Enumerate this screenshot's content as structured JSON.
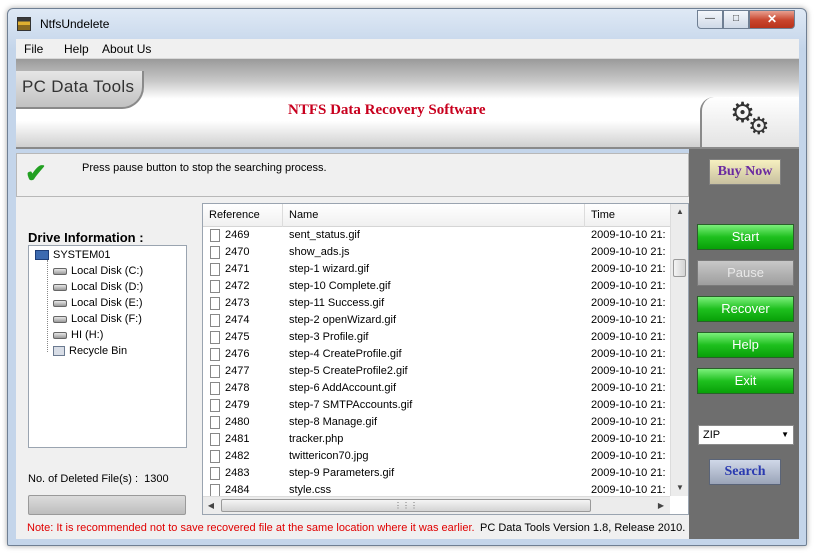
{
  "window": {
    "title": "NtfsUndelete"
  },
  "menu": [
    "File",
    "Help",
    "About Us"
  ],
  "banner": {
    "logo": "PC Data Tools",
    "title": "NTFS Data Recovery Software"
  },
  "status": {
    "message": "Press pause button to stop the searching process."
  },
  "drive_info": {
    "label": "Drive Information :",
    "root": "SYSTEM01",
    "items": [
      "Local Disk (C:)",
      "Local Disk (D:)",
      "Local Disk (E:)",
      "Local Disk (F:)",
      "HI (H:)",
      "Recycle Bin"
    ]
  },
  "deleted": {
    "label": "No. of Deleted File(s) :",
    "count": "1300"
  },
  "table": {
    "columns": [
      "Reference",
      "Name",
      "Time"
    ],
    "rows": [
      {
        "ref": "2469",
        "name": "sent_status.gif",
        "time": "2009-10-10  21:"
      },
      {
        "ref": "2470",
        "name": "show_ads.js",
        "time": "2009-10-10  21:"
      },
      {
        "ref": "2471",
        "name": "step-1 wizard.gif",
        "time": "2009-10-10  21:"
      },
      {
        "ref": "2472",
        "name": "step-10 Complete.gif",
        "time": "2009-10-10  21:"
      },
      {
        "ref": "2473",
        "name": "step-11 Success.gif",
        "time": "2009-10-10  21:"
      },
      {
        "ref": "2474",
        "name": "step-2 openWizard.gif",
        "time": "2009-10-10  21:"
      },
      {
        "ref": "2475",
        "name": "step-3 Profile.gif",
        "time": "2009-10-10  21:"
      },
      {
        "ref": "2476",
        "name": "step-4 CreateProfile.gif",
        "time": "2009-10-10  21:"
      },
      {
        "ref": "2477",
        "name": "step-5 CreateProfile2.gif",
        "time": "2009-10-10  21:"
      },
      {
        "ref": "2478",
        "name": "step-6 AddAccount.gif",
        "time": "2009-10-10  21:"
      },
      {
        "ref": "2479",
        "name": "step-7 SMTPAccounts.gif",
        "time": "2009-10-10  21:"
      },
      {
        "ref": "2480",
        "name": "step-8 Manage.gif",
        "time": "2009-10-10  21:"
      },
      {
        "ref": "2481",
        "name": "tracker.php",
        "time": "2009-10-10  21:"
      },
      {
        "ref": "2482",
        "name": "twittericon70.jpg",
        "time": "2009-10-10  21:"
      },
      {
        "ref": "2483",
        "name": "step-9 Parameters.gif",
        "time": "2009-10-10  21:"
      },
      {
        "ref": "2484",
        "name": "style.css",
        "time": "2009-10-10  21:"
      }
    ]
  },
  "actions": {
    "buy_now": "Buy Now",
    "start": "Start",
    "pause": "Pause",
    "recover": "Recover",
    "help": "Help",
    "exit": "Exit",
    "format_selected": "ZIP",
    "search": "Search"
  },
  "footer": {
    "note": "Note: It is recommended not to save recovered file at the same location where it was earlier.",
    "version": "PC Data Tools Version 1.8, Release 2010."
  },
  "colors": {
    "accent_red": "#c8001e",
    "button_green": "#1ec01e",
    "panel_gray": "#6e6e6e"
  },
  "icons": [
    "app-icon",
    "minimize-icon",
    "maximize-icon",
    "close-icon",
    "check-icon",
    "gear-icon",
    "computer-icon",
    "disk-icon",
    "recycle-bin-icon",
    "file-icon"
  ]
}
